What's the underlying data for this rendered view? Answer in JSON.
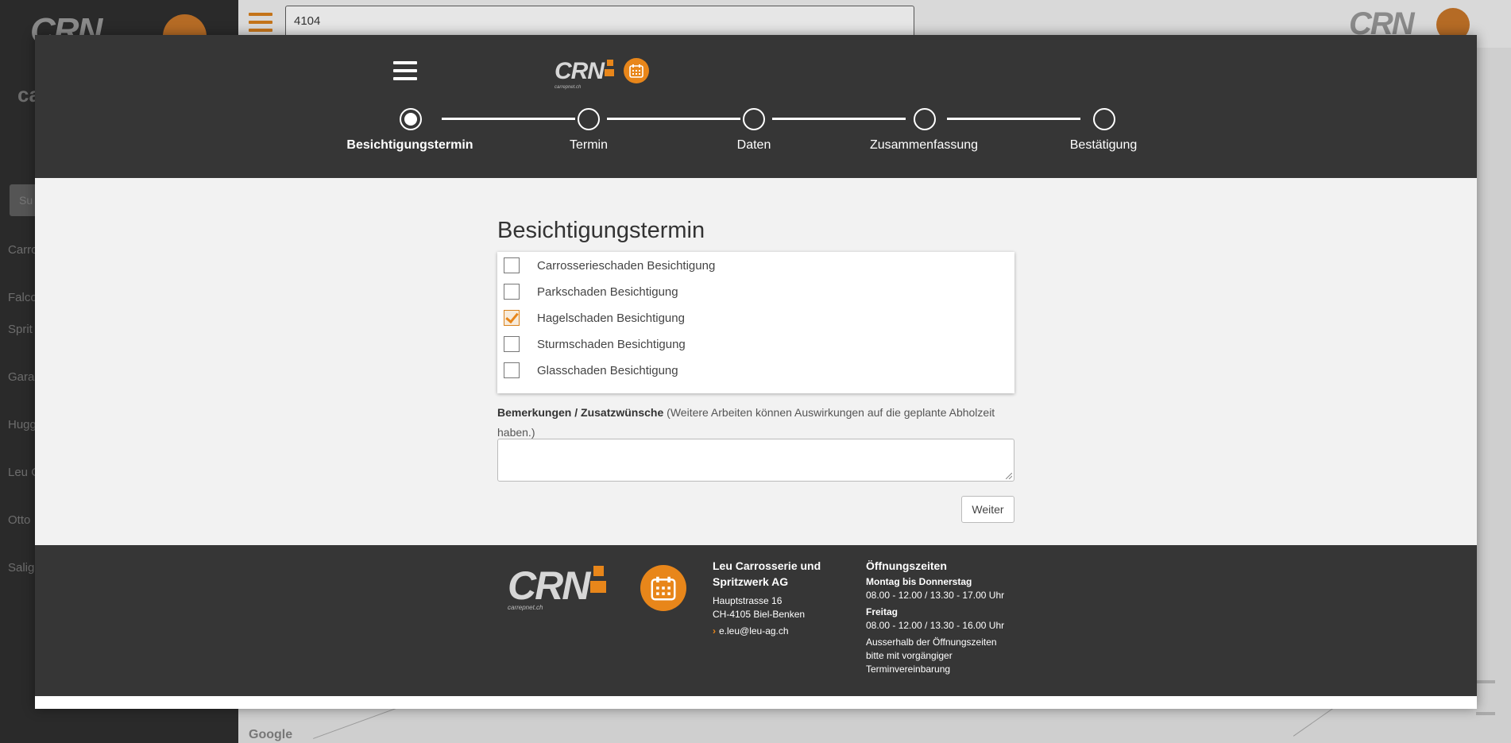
{
  "background": {
    "search_value": "4104",
    "sidebar_heading": "ca",
    "sidebar_button": "Su",
    "sidebar_items": [
      "Carro",
      "Falco",
      "Sprit",
      "Gara",
      "Hugg",
      "Leu C",
      "Otto",
      "Salig"
    ],
    "map_brand": "Google"
  },
  "header": {
    "logo_text": "CRN",
    "logo_sub": "carrepnet.ch"
  },
  "stepper": {
    "steps": [
      {
        "label": "Besichtigungstermin",
        "active": true
      },
      {
        "label": "Termin",
        "active": false
      },
      {
        "label": "Daten",
        "active": false
      },
      {
        "label": "Zusammenfassung",
        "active": false
      },
      {
        "label": "Bestätigung",
        "active": false
      }
    ]
  },
  "form": {
    "title": "Besichtigungstermin",
    "options": [
      {
        "label": "Carrosserieschaden Besichtigung",
        "checked": false
      },
      {
        "label": "Parkschaden Besichtigung",
        "checked": false
      },
      {
        "label": "Hagelschaden Besichtigung",
        "checked": true
      },
      {
        "label": "Sturmschaden Besichtigung",
        "checked": false
      },
      {
        "label": "Glasschaden Besichtigung",
        "checked": false
      }
    ],
    "remarks_label": "Bemerkungen / Zusatzwünsche",
    "remarks_hint": "(Weitere Arbeiten können Auswirkungen auf die geplante Abholzeit haben.)",
    "remarks_value": "",
    "next_button": "Weiter"
  },
  "footer": {
    "logo_text": "CRN",
    "logo_sub": "carrepnet.ch",
    "company_line1": "Leu Carrosserie und",
    "company_line2": "Spritzwerk AG",
    "street": "Hauptstrasse 16",
    "city": "CH-4105 Biel-Benken",
    "email": "e.leu@leu-ag.ch",
    "hours_title": "Öffnungszeiten",
    "hours_days1": "Montag bis Donnerstag",
    "hours_time1": "08.00 - 12.00 / 13.30 - 17.00 Uhr",
    "hours_days2": "Freitag",
    "hours_time2": "08.00 - 12.00 / 13.30 - 16.00 Uhr",
    "hours_note1": "Ausserhalb der Öffnungszeiten",
    "hours_note2": "bitte mit vorgängiger",
    "hours_note3": "Terminvereinbarung"
  },
  "colors": {
    "brand_orange": "#e8861a",
    "dark_bar": "#363636"
  }
}
